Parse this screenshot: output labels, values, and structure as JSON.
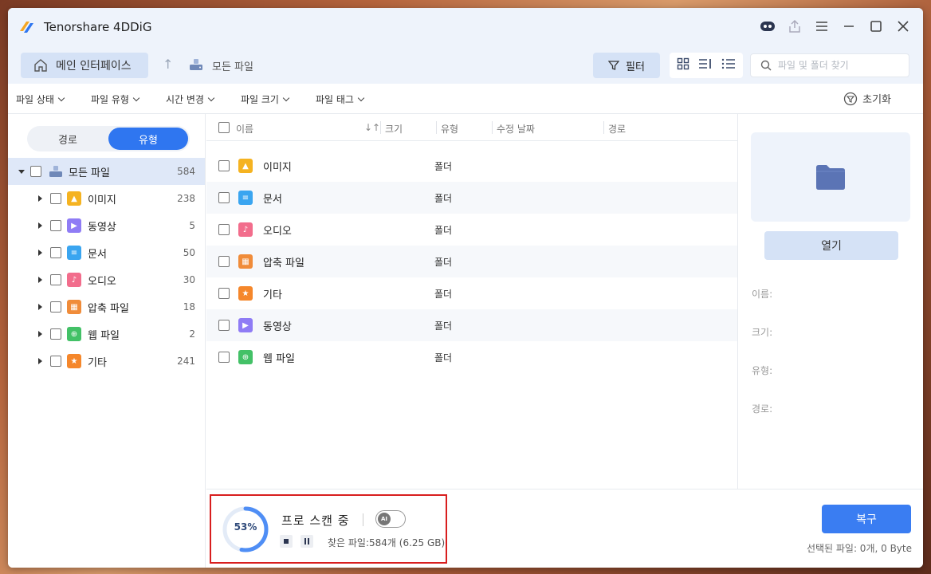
{
  "app": {
    "title": "Tenorshare 4DDiG"
  },
  "nav": {
    "home_label": "메인 인터페이스",
    "crumb": "모든 파일",
    "filter_label": "필터",
    "search_placeholder": "파일 및 폴더 찾기"
  },
  "filters": {
    "items": [
      "파일 상태",
      "파일 유형",
      "시간 변경",
      "파일 크기",
      "파일 태그"
    ],
    "reset_label": "초기화"
  },
  "sidebar": {
    "seg_path": "경로",
    "seg_type": "유형",
    "root": {
      "label": "모든 파일",
      "count": "584"
    },
    "items": [
      {
        "label": "이미지",
        "count": "238",
        "color": "#f5b321",
        "icon": "image-icon"
      },
      {
        "label": "동영상",
        "count": "5",
        "color": "#8f7cf5",
        "icon": "video-icon"
      },
      {
        "label": "문서",
        "count": "50",
        "color": "#3aa5f0",
        "icon": "document-icon"
      },
      {
        "label": "오디오",
        "count": "30",
        "color": "#f26d8c",
        "icon": "audio-icon"
      },
      {
        "label": "압축 파일",
        "count": "18",
        "color": "#f08c3a",
        "icon": "archive-icon"
      },
      {
        "label": "웹 파일",
        "count": "2",
        "color": "#43c167",
        "icon": "web-icon"
      },
      {
        "label": "기타",
        "count": "241",
        "color": "#f5872b",
        "icon": "other-icon"
      }
    ]
  },
  "list": {
    "columns": {
      "name": "이름",
      "size": "크기",
      "type": "유형",
      "modified": "수정 날짜",
      "path": "경로"
    },
    "rows": [
      {
        "name": "이미지",
        "type": "폴더"
      },
      {
        "name": "문서",
        "type": "폴더"
      },
      {
        "name": "오디오",
        "type": "폴더"
      },
      {
        "name": "압축 파일",
        "type": "폴더"
      },
      {
        "name": "기타",
        "type": "폴더"
      },
      {
        "name": "동영상",
        "type": "폴더"
      },
      {
        "name": "웹 파일",
        "type": "폴더"
      }
    ]
  },
  "detail": {
    "open_label": "열기",
    "name_label": "이름:",
    "size_label": "크기:",
    "type_label": "유형:",
    "path_label": "경로:"
  },
  "scan": {
    "percent": "53%",
    "progress_fraction": 0.53,
    "title": "프로 스캔 중",
    "ai_badge": "AI",
    "found": "찾은 파일:584개 (6.25 GB)"
  },
  "footer": {
    "recover_label": "복구",
    "selected": "선택된 파일: 0개, 0 Byte"
  },
  "colors": {
    "accent": "#3a7df2",
    "highlight": "#d5e2f6",
    "scan_border": "#d81e1e"
  }
}
